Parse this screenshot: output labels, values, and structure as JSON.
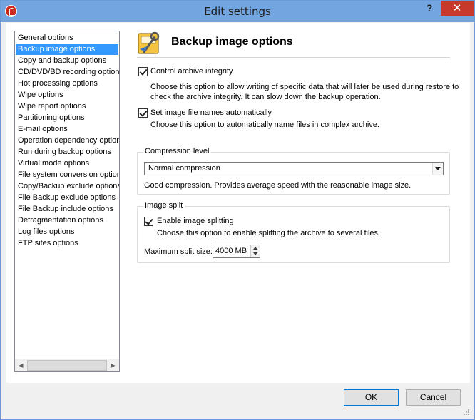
{
  "window": {
    "title": "Edit settings",
    "help_button": "?",
    "close_button": "✕"
  },
  "sidebar": {
    "items": [
      {
        "label": "General options",
        "selected": false
      },
      {
        "label": "Backup image options",
        "selected": true
      },
      {
        "label": "Copy and backup options",
        "selected": false
      },
      {
        "label": "CD/DVD/BD recording options",
        "selected": false
      },
      {
        "label": "Hot processing options",
        "selected": false
      },
      {
        "label": "Wipe options",
        "selected": false
      },
      {
        "label": "Wipe report options",
        "selected": false
      },
      {
        "label": "Partitioning options",
        "selected": false
      },
      {
        "label": "E-mail options",
        "selected": false
      },
      {
        "label": "Operation dependency options",
        "selected": false
      },
      {
        "label": "Run during backup options",
        "selected": false
      },
      {
        "label": "Virtual mode options",
        "selected": false
      },
      {
        "label": "File system conversion options",
        "selected": false
      },
      {
        "label": "Copy/Backup exclude options",
        "selected": false
      },
      {
        "label": "File Backup exclude options",
        "selected": false
      },
      {
        "label": "File Backup include options",
        "selected": false
      },
      {
        "label": "Defragmentation options",
        "selected": false
      },
      {
        "label": "Log files options",
        "selected": false
      },
      {
        "label": "FTP sites options",
        "selected": false
      }
    ],
    "scroll_left": "◀",
    "scroll_right": "▶"
  },
  "main": {
    "title": "Backup image options",
    "control_integrity": {
      "label": "Control archive integrity",
      "checked": true,
      "desc_line1": "Choose this option to allow writing of specific data that will later be used during restore to",
      "desc_line2": "check the archive integrity. It can slow down the backup operation."
    },
    "set_names": {
      "label": "Set image file names automatically",
      "checked": true,
      "desc": "Choose this option to automatically name files in complex archive."
    },
    "compression": {
      "legend": "Compression level",
      "selected": "Normal compression",
      "desc": "Good compression. Provides average speed with the reasonable image size."
    },
    "image_split": {
      "legend": "Image split",
      "checkbox_label": "Enable image splitting",
      "checked": true,
      "desc": "Choose this option to enable splitting the archive to several files",
      "max_size_label": "Maximum split size:",
      "max_size_value": "4000 MB"
    }
  },
  "footer": {
    "ok_label": "OK",
    "cancel_label": "Cancel"
  },
  "colors": {
    "titlebar": "#73a5e0",
    "selection": "#3399ff",
    "close_button": "#c7392c"
  }
}
